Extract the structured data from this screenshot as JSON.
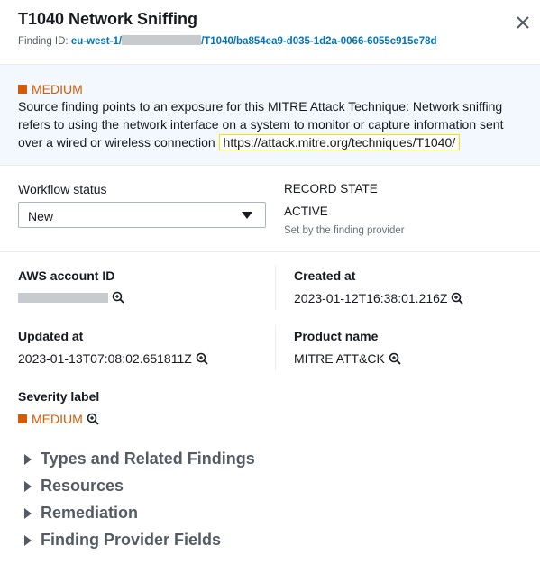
{
  "header": {
    "title": "T1040 Network Sniffing",
    "finding_id_label": "Finding ID:",
    "finding_id_region": "eu-west-1/",
    "finding_id_rest": "/T1040/ba854ea9-d035-1d2a-0066-6055c915e78d"
  },
  "description": {
    "severity": "MEDIUM",
    "text": "Source finding points to an exposure for this MITRE Attack Technique: Network sniffing refers to using the network interface on a system to monitor or capture information sent over a wired or wireless connection",
    "link": "https://attack.mitre.org/techniques/T1040/"
  },
  "workflow": {
    "label": "Workflow status",
    "selected": "New",
    "record_state_label": "RECORD STATE",
    "record_state_value": "ACTIVE",
    "record_state_hint": "Set by the finding provider"
  },
  "fields": {
    "aws_account_label": "AWS account ID",
    "created_label": "Created at",
    "created_value": "2023-01-12T16:38:01.216Z",
    "updated_label": "Updated at",
    "updated_value": "2023-01-13T07:08:02.651811Z",
    "product_label": "Product name",
    "product_value": "MITRE ATT&CK",
    "severity_label": "Severity label",
    "severity_value": "MEDIUM"
  },
  "sections": [
    {
      "label": "Types and Related Findings"
    },
    {
      "label": "Resources"
    },
    {
      "label": "Remediation"
    },
    {
      "label": "Finding Provider Fields"
    }
  ],
  "colors": {
    "accent": "#0073bb",
    "severity_medium": "#d45b07",
    "highlight_band": "#f2f8fd"
  }
}
